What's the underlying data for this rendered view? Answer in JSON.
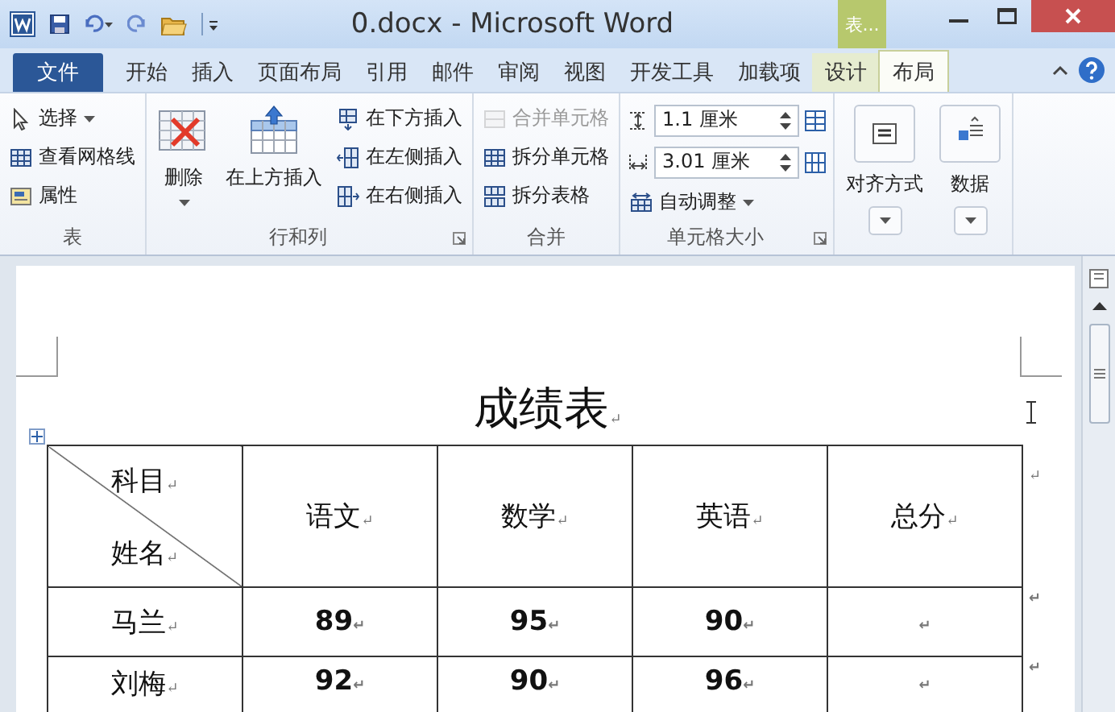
{
  "window": {
    "title": "0.docx - Microsoft Word",
    "context_tab": "表..."
  },
  "tabs": [
    {
      "label": "文件",
      "kind": "file",
      "selected": false
    },
    {
      "label": "开始",
      "kind": "normal",
      "selected": false
    },
    {
      "label": "插入",
      "kind": "normal",
      "selected": false
    },
    {
      "label": "页面布局",
      "kind": "normal",
      "selected": false
    },
    {
      "label": "引用",
      "kind": "normal",
      "selected": false
    },
    {
      "label": "邮件",
      "kind": "normal",
      "selected": false
    },
    {
      "label": "审阅",
      "kind": "normal",
      "selected": false
    },
    {
      "label": "视图",
      "kind": "normal",
      "selected": false
    },
    {
      "label": "开发工具",
      "kind": "normal",
      "selected": false
    },
    {
      "label": "加载项",
      "kind": "normal",
      "selected": false
    },
    {
      "label": "设计",
      "kind": "context",
      "selected": false
    },
    {
      "label": "布局",
      "kind": "context",
      "selected": true
    }
  ],
  "ribbon": {
    "groups": [
      {
        "label": "表",
        "items": [
          {
            "label": "选择",
            "kind": "small",
            "dropdown": true,
            "disabled": false
          },
          {
            "label": "查看网格线",
            "kind": "small",
            "disabled": false
          },
          {
            "label": "属性",
            "kind": "small",
            "disabled": false
          }
        ]
      },
      {
        "label": "行和列",
        "launcher": true,
        "items": [
          {
            "label": "删除",
            "kind": "large",
            "dropdown": true,
            "disabled": false
          },
          {
            "label": "在上方插入",
            "kind": "large",
            "disabled": false
          },
          {
            "label": "在下方插入",
            "kind": "small",
            "disabled": false
          },
          {
            "label": "在左侧插入",
            "kind": "small",
            "disabled": false
          },
          {
            "label": "在右侧插入",
            "kind": "small",
            "disabled": false
          }
        ]
      },
      {
        "label": "合并",
        "items": [
          {
            "label": "合并单元格",
            "kind": "small",
            "disabled": true
          },
          {
            "label": "拆分单元格",
            "kind": "small",
            "disabled": false
          },
          {
            "label": "拆分表格",
            "kind": "small",
            "disabled": false
          }
        ]
      },
      {
        "label": "单元格大小",
        "launcher": true,
        "items": [
          {
            "label": "1.1 厘米",
            "kind": "spinner",
            "disabled": false
          },
          {
            "label": "3.01 厘米",
            "kind": "spinner",
            "disabled": false
          },
          {
            "label": "自动调整",
            "kind": "small",
            "dropdown": true,
            "disabled": false
          }
        ]
      },
      {
        "items": [
          {
            "label": "对齐方式",
            "kind": "large",
            "dropdown": true,
            "disabled": false
          },
          {
            "label": "数据",
            "kind": "large",
            "dropdown": true,
            "disabled": false
          }
        ]
      }
    ]
  },
  "document": {
    "title": "成绩表$_{↵}$",
    "table": {
      "corner_top": "科目$_{↵}$",
      "corner_bottom": "姓名$_{↵}$",
      "columns": [
        "语文$_{↵}$",
        "数学$_{↵}$",
        "英语$_{↵}$",
        "总分$_{↵}$"
      ],
      "header_end_mark": "↵",
      "rows": [
        {
          "name": "马兰$_{↵}$",
          "cells": [
            "89$_{↵}$",
            "95$_{↵}$",
            "90$_{↵}$",
            "$_{↵}$"
          ],
          "end_mark": "↵"
        },
        {
          "name": "刘梅$_{↵}$",
          "cells": [
            "92$_{↵}$",
            "90$_{↵}$",
            "96$_{↵}$",
            "$_{↵}$"
          ],
          "end_mark": "↵"
        }
      ]
    }
  }
}
